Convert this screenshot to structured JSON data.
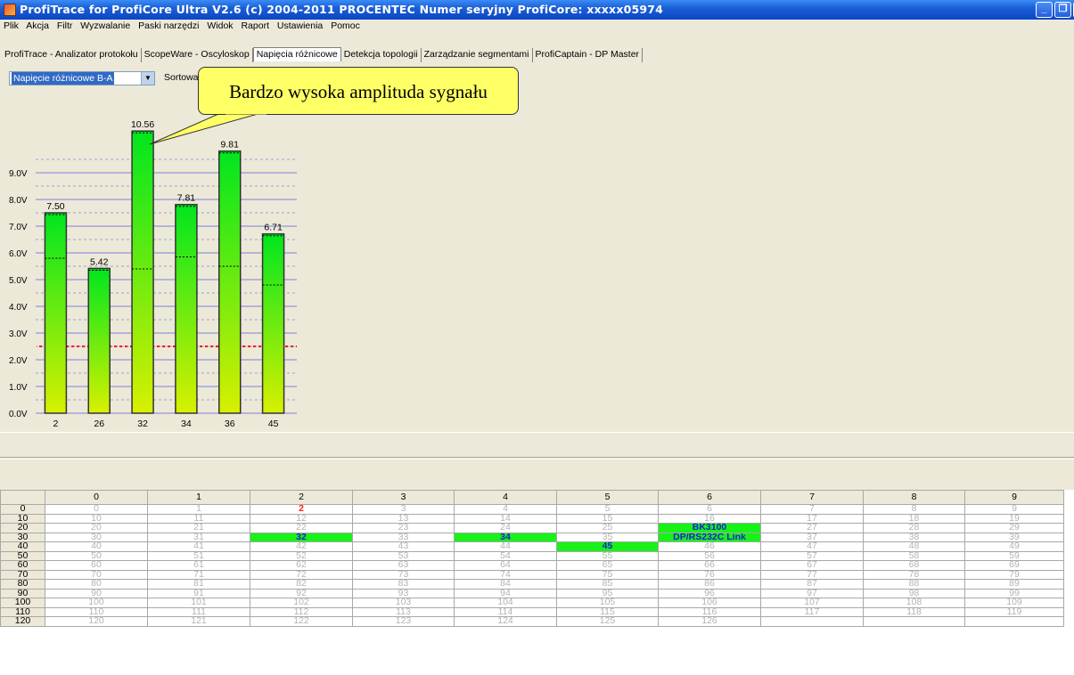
{
  "window": {
    "title": "ProfiTrace for ProfiCore Ultra V2.6 (c) 2004-2011 PROCENTEC  Numer seryjny ProfiCore: xxxxx05974",
    "min_glyph": "_",
    "max_glyph": "❐",
    "close_glyph": "X"
  },
  "menu": [
    "Plik",
    "Akcja",
    "Filtr",
    "Wyzwalanie",
    "Paski narzędzi",
    "Widok",
    "Raport",
    "Ustawienia",
    "Pomoc"
  ],
  "tabs": [
    {
      "label": "ProfiTrace - Analizator protokołu",
      "active": false
    },
    {
      "label": "ScopeWare - Oscyloskop",
      "active": false
    },
    {
      "label": "Napięcia różnicowe",
      "active": true
    },
    {
      "label": "Detekcja topologii",
      "active": false
    },
    {
      "label": "Zarządzanie segmentami",
      "active": false
    },
    {
      "label": "ProfiCaptain - DP Master",
      "active": false
    }
  ],
  "toolbar": {
    "select_value": "Napięcie różnicowe B-A",
    "sort_label": "Sortowa"
  },
  "callout": "Bardzo wysoka amplituda sygnału",
  "chart_data": {
    "type": "bar",
    "categories": [
      "2",
      "26",
      "32",
      "34",
      "36",
      "45"
    ],
    "values": [
      7.5,
      5.42,
      10.56,
      7.81,
      9.81,
      6.71
    ],
    "value_labels": [
      "7.50",
      "5.42",
      "10.56",
      "7.81",
      "9.81",
      "6.71"
    ],
    "inner_marks": [
      5.8,
      5.35,
      5.4,
      5.85,
      5.5,
      4.8
    ],
    "yticks": [
      "0.0V",
      "1.0V",
      "2.0V",
      "3.0V",
      "4.0V",
      "5.0V",
      "6.0V",
      "7.0V",
      "8.0V",
      "9.0V"
    ],
    "ylim": [
      0,
      10
    ],
    "threshold": 2.5,
    "colors": {
      "bar_top": "#00e61e",
      "bar_bottom": "#d8f000",
      "threshold": "#ff0000",
      "grid": "#8080e0"
    }
  },
  "grid": {
    "columns": [
      "0",
      "1",
      "2",
      "3",
      "4",
      "5",
      "6",
      "7",
      "8",
      "9"
    ],
    "rows": [
      {
        "label": "0",
        "cells": [
          "0",
          "1",
          "2",
          "3",
          "4",
          "5",
          "6",
          "7",
          "8",
          "9"
        ]
      },
      {
        "label": "10",
        "cells": [
          "10",
          "11",
          "12",
          "13",
          "14",
          "15",
          "16",
          "17",
          "18",
          "19"
        ]
      },
      {
        "label": "20",
        "cells": [
          "20",
          "21",
          "22",
          "23",
          "24",
          "25",
          "BK3100",
          "27",
          "28",
          "29"
        ]
      },
      {
        "label": "30",
        "cells": [
          "30",
          "31",
          "32",
          "33",
          "34",
          "35",
          "DP/RS232C Link",
          "37",
          "38",
          "39"
        ]
      },
      {
        "label": "40",
        "cells": [
          "40",
          "41",
          "42",
          "43",
          "44",
          "45",
          "46",
          "47",
          "48",
          "49"
        ]
      },
      {
        "label": "50",
        "cells": [
          "50",
          "51",
          "52",
          "53",
          "54",
          "55",
          "56",
          "57",
          "58",
          "59"
        ]
      },
      {
        "label": "60",
        "cells": [
          "60",
          "61",
          "62",
          "63",
          "64",
          "65",
          "66",
          "67",
          "68",
          "69"
        ]
      },
      {
        "label": "70",
        "cells": [
          "70",
          "71",
          "72",
          "73",
          "74",
          "75",
          "76",
          "77",
          "78",
          "79"
        ]
      },
      {
        "label": "80",
        "cells": [
          "80",
          "81",
          "82",
          "83",
          "84",
          "85",
          "86",
          "87",
          "88",
          "89"
        ]
      },
      {
        "label": "90",
        "cells": [
          "90",
          "91",
          "92",
          "93",
          "94",
          "95",
          "96",
          "97",
          "98",
          "99"
        ]
      },
      {
        "label": "100",
        "cells": [
          "100",
          "101",
          "102",
          "103",
          "104",
          "105",
          "106",
          "107",
          "108",
          "109"
        ]
      },
      {
        "label": "110",
        "cells": [
          "110",
          "111",
          "112",
          "113",
          "114",
          "115",
          "116",
          "117",
          "118",
          "119"
        ]
      },
      {
        "label": "120",
        "cells": [
          "120",
          "121",
          "122",
          "123",
          "124",
          "125",
          "126",
          "",
          "",
          ""
        ]
      }
    ],
    "active_cells": [
      "2:6",
      "3:2",
      "3:4",
      "3:6",
      "4:5"
    ],
    "alert_cells": [
      "0:2"
    ]
  }
}
